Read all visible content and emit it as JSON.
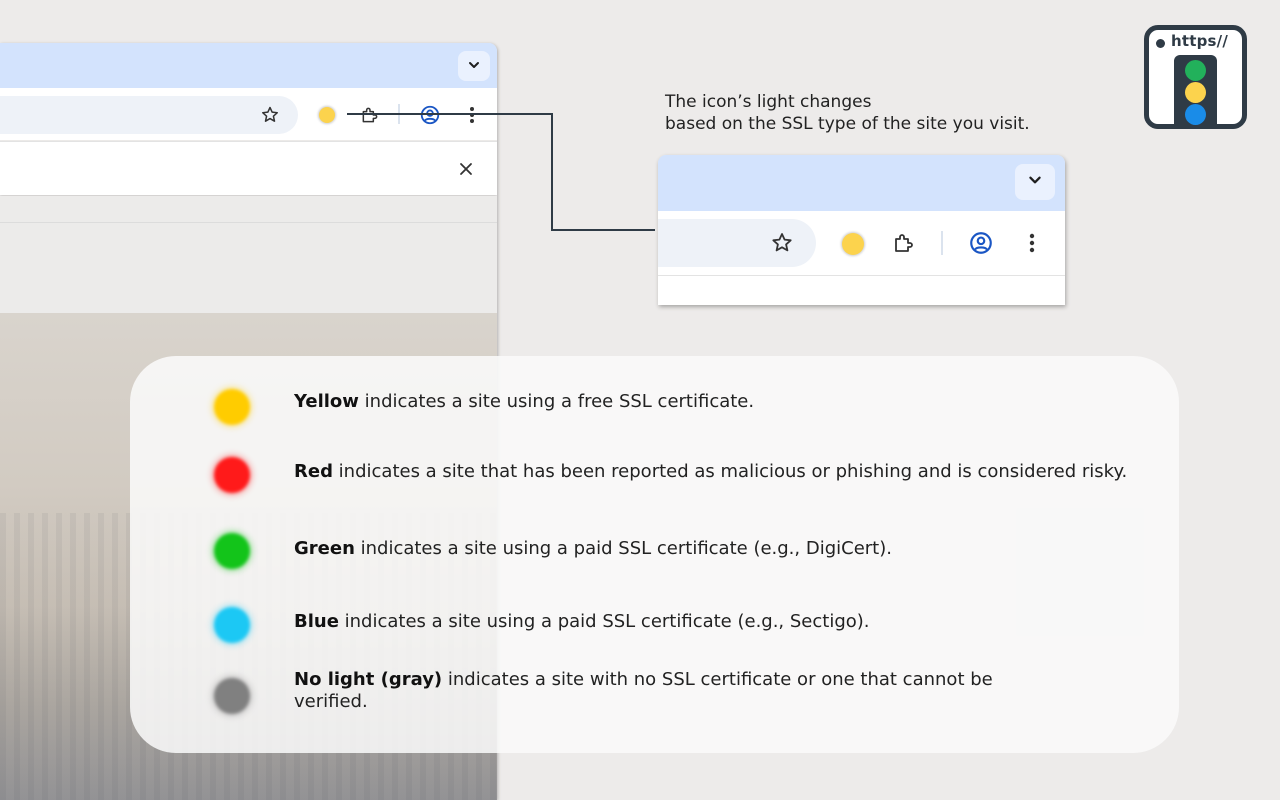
{
  "caption": {
    "line1": "The icon’s light changes",
    "line2": "based on the SSL type of the site you visit."
  },
  "logo": {
    "text": "https//",
    "lights": [
      "#22b15b",
      "#fcd34d",
      "#1a8ce8"
    ]
  },
  "extension_icon_color": "#fcd34d",
  "legend": [
    {
      "color": "#ffcc00",
      "label": "Yellow",
      "text": " indicates a site using a free SSL certificate."
    },
    {
      "color": "#ff1a1a",
      "label": "Red",
      "text": " indicates a site that has been reported as malicious or phishing and is considered risky."
    },
    {
      "color": "#13c41a",
      "label": "Green",
      "text": " indicates a site using a paid SSL certificate (e.g., DigiCert)."
    },
    {
      "color": "#1cc8f4",
      "label": "Blue",
      "text": " indicates a site using a paid SSL certificate (e.g., Sectigo)."
    },
    {
      "color": "#808080",
      "label": "No light (gray)",
      "text": " indicates a site with no SSL certificate or one that cannot be",
      "text2": "verified."
    }
  ]
}
